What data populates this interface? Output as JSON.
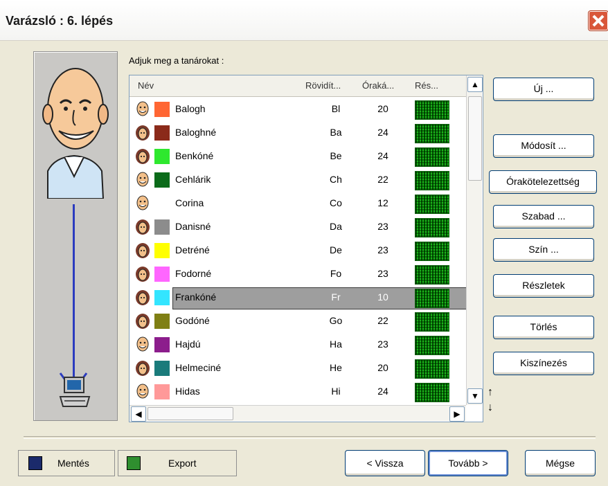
{
  "window": {
    "title": "Varázsló : 6. lépés"
  },
  "prompt": "Adjuk meg a tanárokat :",
  "columns": {
    "name": "Név",
    "abbr": "Rövidít...",
    "hours": "Óraká...",
    "detail": "Rés..."
  },
  "rows": [
    {
      "name": "Balogh",
      "abbr": "Bl",
      "hours": "20",
      "gender": "m",
      "color": "#ff6633"
    },
    {
      "name": "Baloghné",
      "abbr": "Ba",
      "hours": "24",
      "gender": "f",
      "color": "#8b2a1a"
    },
    {
      "name": "Benkóné",
      "abbr": "Be",
      "hours": "24",
      "gender": "f",
      "color": "#2ee82e"
    },
    {
      "name": "Cehlárik",
      "abbr": "Ch",
      "hours": "22",
      "gender": "m",
      "color": "#0b6b1a"
    },
    {
      "name": "Corina",
      "abbr": "Co",
      "hours": "12",
      "gender": "m",
      "color": ""
    },
    {
      "name": "Danisné",
      "abbr": "Da",
      "hours": "23",
      "gender": "f",
      "color": "#8c8c8c"
    },
    {
      "name": "Detréné",
      "abbr": "De",
      "hours": "23",
      "gender": "f",
      "color": "#ffff00"
    },
    {
      "name": "Fodorné",
      "abbr": "Fo",
      "hours": "23",
      "gender": "f",
      "color": "#ff66ff"
    },
    {
      "name": "Frankóné",
      "abbr": "Fr",
      "hours": "10",
      "gender": "f",
      "color": "#33e5ff",
      "selected": true
    },
    {
      "name": "Godóné",
      "abbr": "Go",
      "hours": "22",
      "gender": "f",
      "color": "#7f7f14"
    },
    {
      "name": "Hajdú",
      "abbr": "Ha",
      "hours": "23",
      "gender": "m",
      "color": "#8c1d8c"
    },
    {
      "name": "Helmeciné",
      "abbr": "He",
      "hours": "20",
      "gender": "f",
      "color": "#1a7b7b"
    },
    {
      "name": "Hidas",
      "abbr": "Hi",
      "hours": "24",
      "gender": "m",
      "color": "#ff9999"
    }
  ],
  "side_buttons": {
    "new": "Új ...",
    "modify": "Módosít ...",
    "obligation": "Órakötelezettség",
    "free": "Szabad ...",
    "color": "Szín ...",
    "details": "Részletek",
    "delete": "Törlés",
    "colorize": "Kiszínezés"
  },
  "bottom": {
    "save": "Mentés",
    "export": "Export",
    "back": "< Vissza",
    "next": "Tovább >",
    "cancel": "Mégse"
  }
}
